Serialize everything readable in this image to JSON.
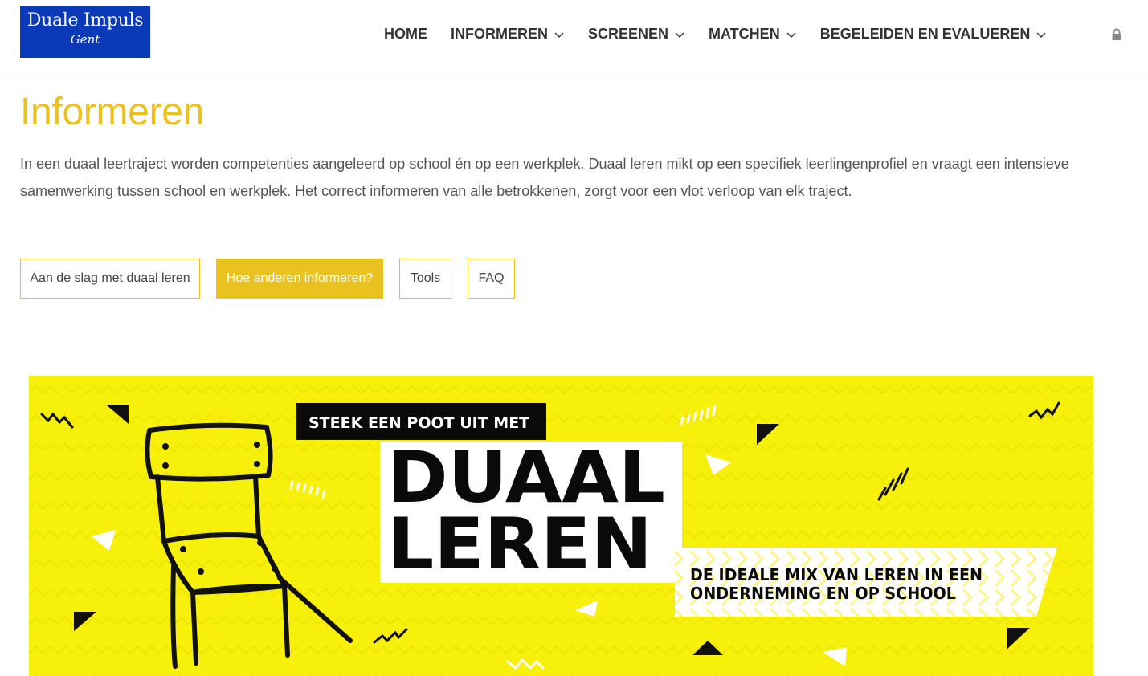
{
  "logo": {
    "line1": "Duale Impuls",
    "line2": "Gent",
    "bg_color": "#0a3ab7"
  },
  "nav": {
    "items": [
      {
        "label": "HOME",
        "dropdown": false
      },
      {
        "label": "INFORMEREN",
        "dropdown": true
      },
      {
        "label": "SCREENEN",
        "dropdown": true
      },
      {
        "label": "MATCHEN",
        "dropdown": true
      },
      {
        "label": "BEGELEIDEN EN EVALUEREN",
        "dropdown": true
      }
    ],
    "lock_icon": "lock-icon"
  },
  "page": {
    "title": "Informeren",
    "intro": "In een duaal leertraject worden competenties aangeleerd op school én op een werkplek. Duaal leren mikt op een specifiek leerlingenprofiel en vraagt een intensieve samenwerking tussen school en werkplek. Het correct informeren van alle betrokkenen, zorgt voor een vlot verloop van elk traject."
  },
  "tabs": [
    {
      "label": "Aan de slag met duaal leren",
      "active": false
    },
    {
      "label": "Hoe anderen informeren?",
      "active": true
    },
    {
      "label": "Tools",
      "active": false
    },
    {
      "label": "FAQ",
      "active": false
    }
  ],
  "banner": {
    "tagline": "STEEK EEN POOT UIT MET",
    "word1": "DUAAL",
    "word2": "LEREN",
    "slogan_line1": "DE IDEALE MIX VAN LEREN IN EEN",
    "slogan_line2": "ONDERNEMING EN OP SCHOOL",
    "bg_color": "#f6f00a"
  },
  "colors": {
    "accent": "#e9c220",
    "text": "#555555"
  }
}
